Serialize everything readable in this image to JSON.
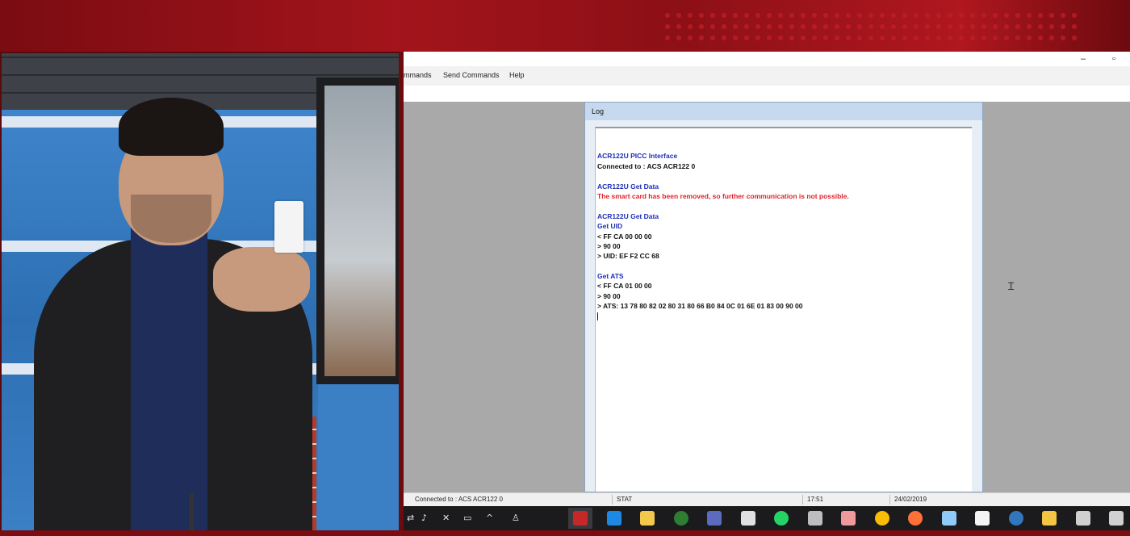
{
  "app": {
    "menu": [
      "mmands",
      "Send Commands",
      "Help"
    ],
    "window_controls": {
      "minimize": "–",
      "maximize": "▫"
    }
  },
  "log": {
    "title": "Log",
    "lines": [
      {
        "text": "",
        "kind": "gap"
      },
      {
        "text": "ACR122U PICC Interface",
        "kind": "heading"
      },
      {
        "text": "Connected to : ACS ACR122 0",
        "kind": "normal"
      },
      {
        "text": "",
        "kind": "gap"
      },
      {
        "text": "ACR122U Get Data",
        "kind": "heading"
      },
      {
        "text": "The smart card has been removed, so further communication is not possible.",
        "kind": "error"
      },
      {
        "text": "",
        "kind": "gap"
      },
      {
        "text": "ACR122U Get Data",
        "kind": "heading"
      },
      {
        "text": "Get UID",
        "kind": "heading"
      },
      {
        "text": "< FF CA 00 00 00",
        "kind": "normal"
      },
      {
        "text": "> 90 00",
        "kind": "normal"
      },
      {
        "text": "> UID: EF F2 CC 68",
        "kind": "normal"
      },
      {
        "text": "",
        "kind": "gap"
      },
      {
        "text": "Get ATS",
        "kind": "heading"
      },
      {
        "text": "< FF CA 01 00 00",
        "kind": "normal"
      },
      {
        "text": "> 90 00",
        "kind": "normal"
      },
      {
        "text": "> ATS: 13 78 80 82 02 80 31 80 66 B0 84 0C 01 6E 01 83 00 90 00",
        "kind": "normal"
      }
    ]
  },
  "statusbar": {
    "connection": "Connected to : ACS ACR122 0",
    "state": "STAT",
    "time": "17:51",
    "date": "24/02/2019"
  },
  "taskbar": {
    "icons": [
      {
        "name": "acs-app-icon",
        "color": "#c62828"
      },
      {
        "name": "internet-explorer-icon",
        "color": "#1e88e5"
      },
      {
        "name": "sticky-notes-icon",
        "color": "#f2c94c"
      },
      {
        "name": "green-app-icon",
        "color": "#2e7d32"
      },
      {
        "name": "network-tool-icon",
        "color": "#5c6bc0"
      },
      {
        "name": "calculator-icon",
        "color": "#e0e0e0"
      },
      {
        "name": "whatsapp-icon",
        "color": "#25d366"
      },
      {
        "name": "device-icon",
        "color": "#bdbdbd"
      },
      {
        "name": "chat-app-icon",
        "color": "#ef9a9a"
      },
      {
        "name": "chrome-icon",
        "color": "#fbbc05"
      },
      {
        "name": "firefox-icon",
        "color": "#ff7139"
      },
      {
        "name": "notepad-icon",
        "color": "#90caf9"
      },
      {
        "name": "store-icon",
        "color": "#f5f5f5"
      },
      {
        "name": "edge-icon",
        "color": "#3277bc"
      },
      {
        "name": "file-explorer-icon",
        "color": "#f4c542"
      },
      {
        "name": "task-view-icon",
        "color": "#d0d0d0"
      },
      {
        "name": "search-icon",
        "color": "#d0d0d0"
      }
    ]
  }
}
